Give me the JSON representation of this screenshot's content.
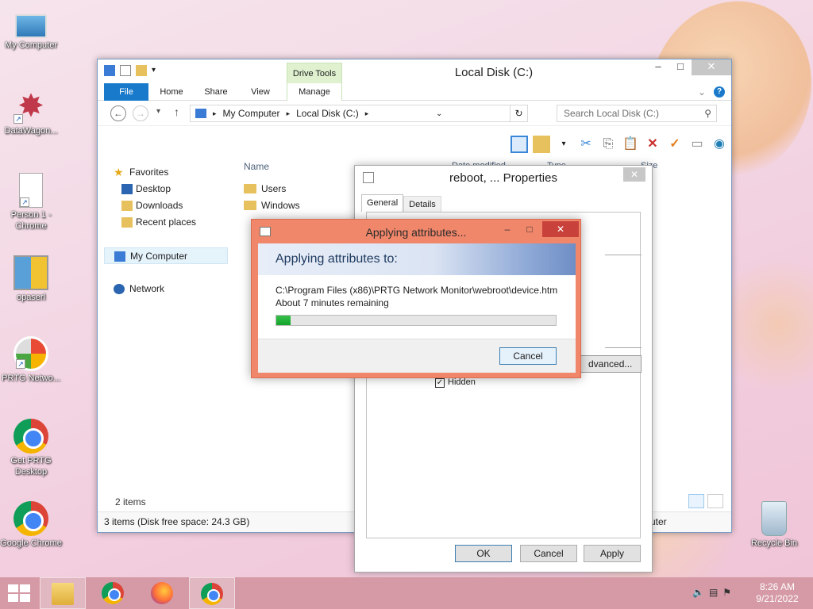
{
  "desktop": {
    "icons": [
      {
        "label": "My Computer"
      },
      {
        "label": "DataWagon..."
      },
      {
        "label": "Person 1 - Chrome"
      },
      {
        "label": "opaserl"
      },
      {
        "label": "PRTG Netwo..."
      },
      {
        "label": "Get PRTG Desktop"
      },
      {
        "label": "Google Chrome"
      },
      {
        "label": "Recycle Bin"
      }
    ]
  },
  "explorer": {
    "title": "Local Disk (C:)",
    "contextual_tab_group": "Drive Tools",
    "tabs": {
      "file": "File",
      "home": "Home",
      "share": "Share",
      "view": "View",
      "manage": "Manage"
    },
    "address": {
      "root": "My Computer",
      "current": "Local Disk (C:)"
    },
    "search_placeholder": "Search Local Disk (C:)",
    "nav": {
      "favorites": "Favorites",
      "desktop": "Desktop",
      "downloads": "Downloads",
      "recent": "Recent places",
      "my_computer": "My Computer",
      "network": "Network"
    },
    "columns": {
      "name": "Name",
      "date": "Date modified",
      "type": "Type",
      "size": "Size"
    },
    "files": [
      {
        "name": "Users"
      },
      {
        "name": "Windows"
      }
    ],
    "items_count": "2 items",
    "status": "3 items (Disk free space: 24.3 GB)",
    "status_right": "uter"
  },
  "properties": {
    "title": "reboot, ... Properties",
    "tabs": {
      "general": "General",
      "details": "Details"
    },
    "advanced_label": "dvanced...",
    "hidden_label": "Hidden",
    "hidden_checked": "✓",
    "ok": "OK",
    "cancel": "Cancel",
    "apply": "Apply"
  },
  "apply_dialog": {
    "title": "Applying attributes...",
    "header": "Applying attributes to:",
    "path": "C:\\Program Files (x86)\\PRTG Network Monitor\\webroot\\device.htm",
    "remaining": "About 7 minutes remaining",
    "progress": 0.05,
    "cancel": "Cancel"
  },
  "taskbar": {
    "time": "8:26 AM",
    "date": "9/21/2022"
  }
}
